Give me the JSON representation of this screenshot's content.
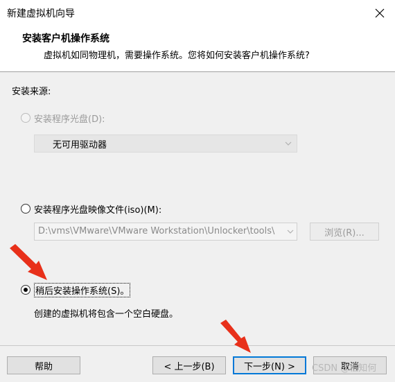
{
  "window": {
    "title": "新建虚拟机向导",
    "close_icon": "close-icon"
  },
  "header": {
    "title": "安装客户机操作系统",
    "subtitle": "虚拟机如同物理机，需要操作系统。您将如何安装客户机操作系统?"
  },
  "install_source": {
    "label": "安装来源:",
    "option_disc": {
      "label": "安装程序光盘(D):",
      "checked": false,
      "enabled": false
    },
    "disc_select": {
      "value": "无可用驱动器",
      "enabled": false
    },
    "option_iso": {
      "label": "安装程序光盘映像文件(iso)(M):",
      "checked": false,
      "enabled": true
    },
    "iso_path": {
      "value": "D:\\vms\\VMware\\VMware Workstation\\Unlocker\\tools\\",
      "enabled": false
    },
    "browse_label": "浏览(R)...",
    "option_later": {
      "label": "稍后安装操作系统(S)。",
      "checked": true,
      "enabled": true
    },
    "later_description": "创建的虚拟机将包含一个空白硬盘。"
  },
  "footer": {
    "help_label": "帮助",
    "back_label": "< 上一步(B)",
    "next_label": "下一步(N) >",
    "cancel_label": "取消"
  },
  "watermark": "CSDN @稻知何",
  "colors": {
    "accent": "#0078d7",
    "annotation_arrow": "#e8301a"
  }
}
